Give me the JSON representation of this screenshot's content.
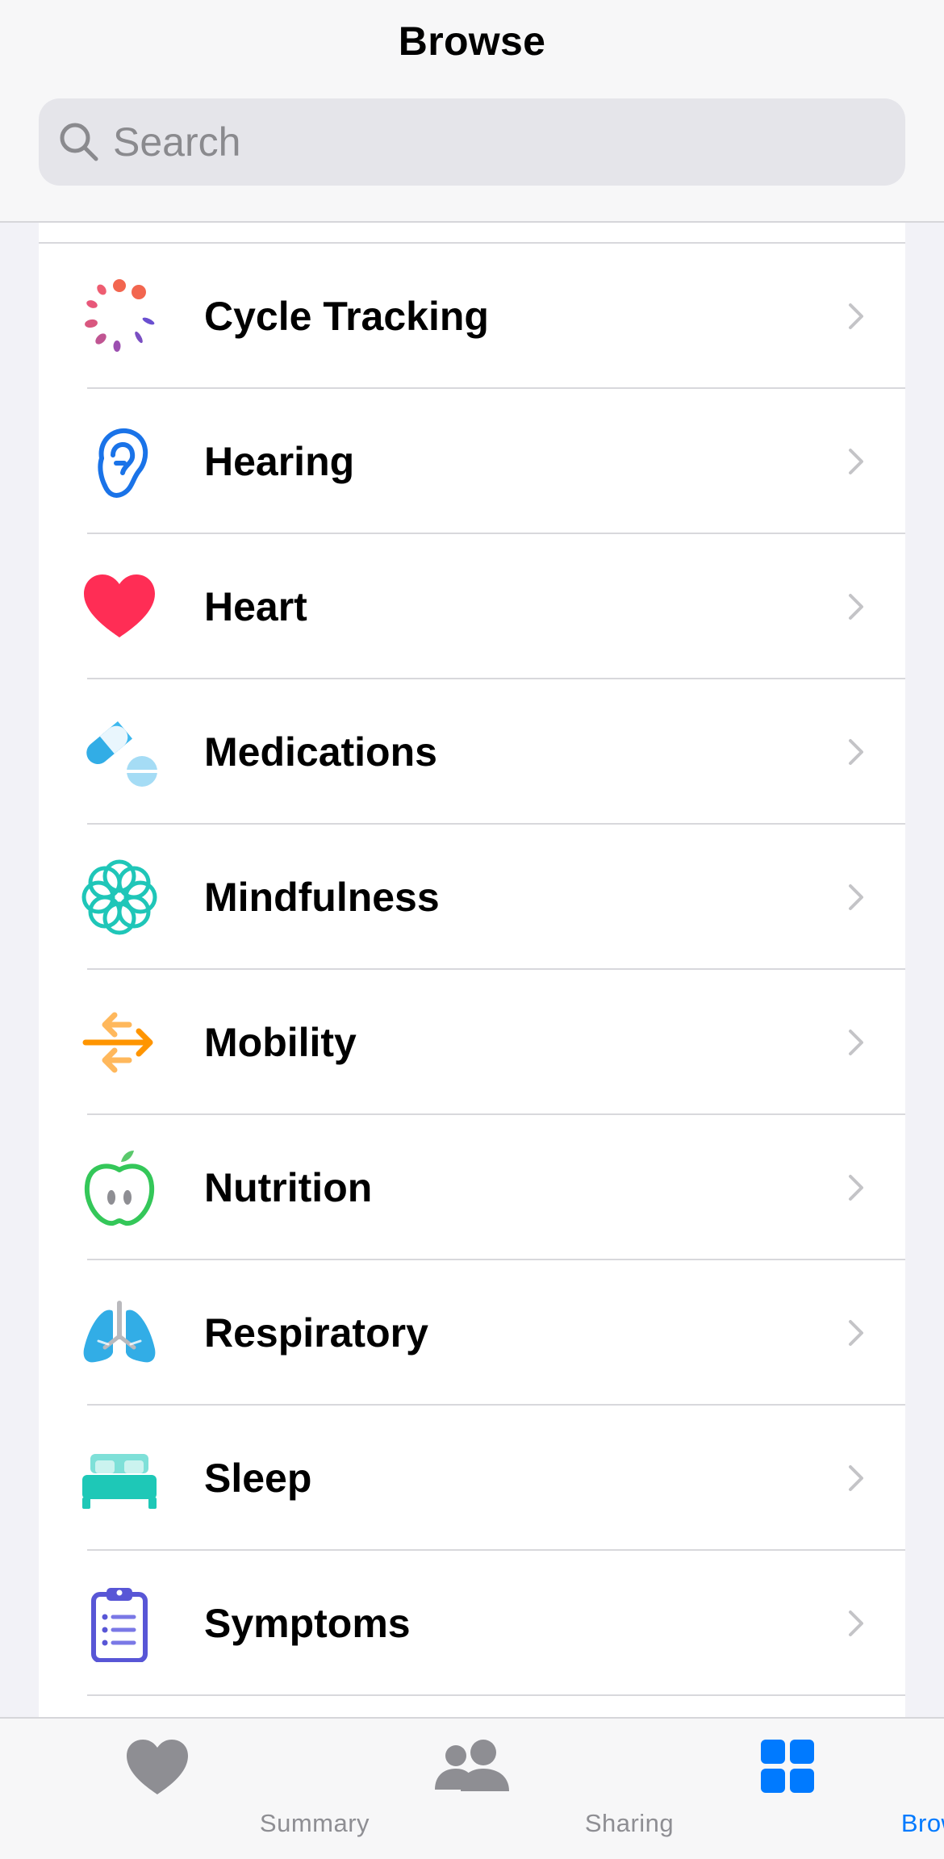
{
  "header": {
    "title": "Browse"
  },
  "search": {
    "placeholder": "Search",
    "icon": "magnifying-glass"
  },
  "categories": [
    {
      "label": "Cycle Tracking",
      "icon": "cycle-tracking-icon"
    },
    {
      "label": "Hearing",
      "icon": "ear-icon"
    },
    {
      "label": "Heart",
      "icon": "heart-icon"
    },
    {
      "label": "Medications",
      "icon": "pills-icon"
    },
    {
      "label": "Mindfulness",
      "icon": "flower-icon"
    },
    {
      "label": "Mobility",
      "icon": "arrows-icon"
    },
    {
      "label": "Nutrition",
      "icon": "apple-icon"
    },
    {
      "label": "Respiratory",
      "icon": "lungs-icon"
    },
    {
      "label": "Sleep",
      "icon": "bed-icon"
    },
    {
      "label": "Symptoms",
      "icon": "clipboard-icon"
    }
  ],
  "tabbar": {
    "tabs": [
      {
        "label": "Summary",
        "icon": "heart-icon",
        "active": false
      },
      {
        "label": "Sharing",
        "icon": "people-icon",
        "active": false
      },
      {
        "label": "Browse",
        "icon": "grid-icon",
        "active": true
      }
    ]
  },
  "colors": {
    "accent": "#007aff",
    "heart": "#ff2d55",
    "hearing": "#1a73e8",
    "medications": "#32ade6",
    "mindfulness": "#1fc6b8",
    "mobility": "#ff9500",
    "nutrition": "#34c759",
    "respiratory": "#32ade6",
    "sleep": "#1ec8b7",
    "symptoms": "#5856d6"
  }
}
